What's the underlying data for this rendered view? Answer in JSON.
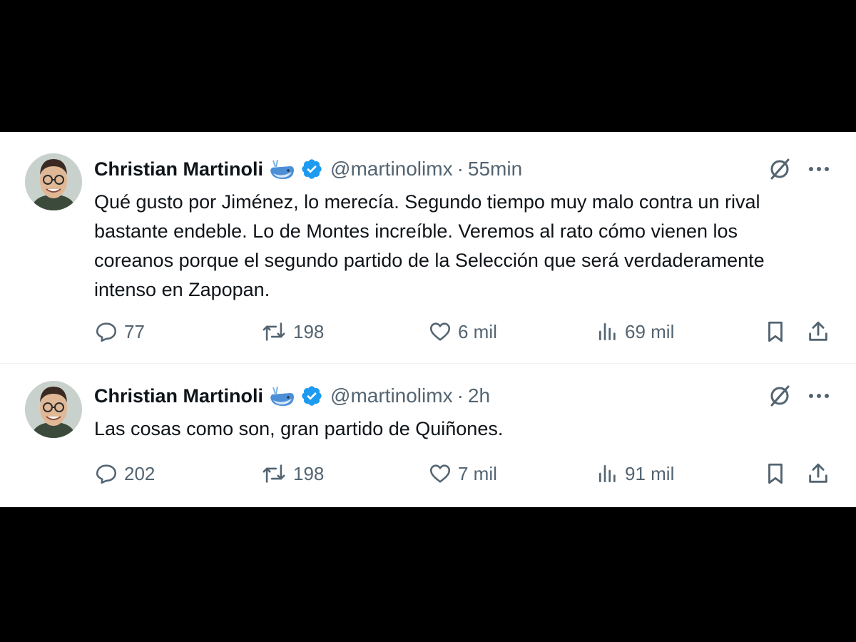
{
  "tweets": [
    {
      "author_name": "Christian Martinoli",
      "handle": "@martinolimx",
      "separator": "·",
      "time": "55min",
      "text": "Qué gusto por Jiménez, lo merecía. Segundo tiempo muy malo contra un rival bastante endeble. Lo de Montes increíble. Veremos al rato cómo vienen los coreanos porque el segundo partido de la Selección que será verdaderamente intenso en Zapopan.",
      "replies": "77",
      "reposts": "198",
      "likes": "6 mil",
      "views": "69 mil"
    },
    {
      "author_name": "Christian Martinoli",
      "handle": "@martinolimx",
      "separator": "·",
      "time": "2h",
      "text": "Las cosas como son, gran partido de Quiñones.",
      "replies": "202",
      "reposts": "198",
      "likes": "7 mil",
      "views": "91 mil"
    }
  ],
  "icons": {
    "reply": "reply-icon",
    "repost": "repost-icon",
    "like": "heart-icon",
    "views": "views-icon",
    "bookmark": "bookmark-icon",
    "share": "share-icon",
    "grok": "grok-icon",
    "more": "more-icon",
    "verified": "verified-badge-icon",
    "whale": "whale-emoji-icon"
  },
  "colors": {
    "verified": "#1d9bf0",
    "text_primary": "#0f1419",
    "text_secondary": "#536471",
    "background": "#ffffff",
    "frame": "#000000"
  }
}
